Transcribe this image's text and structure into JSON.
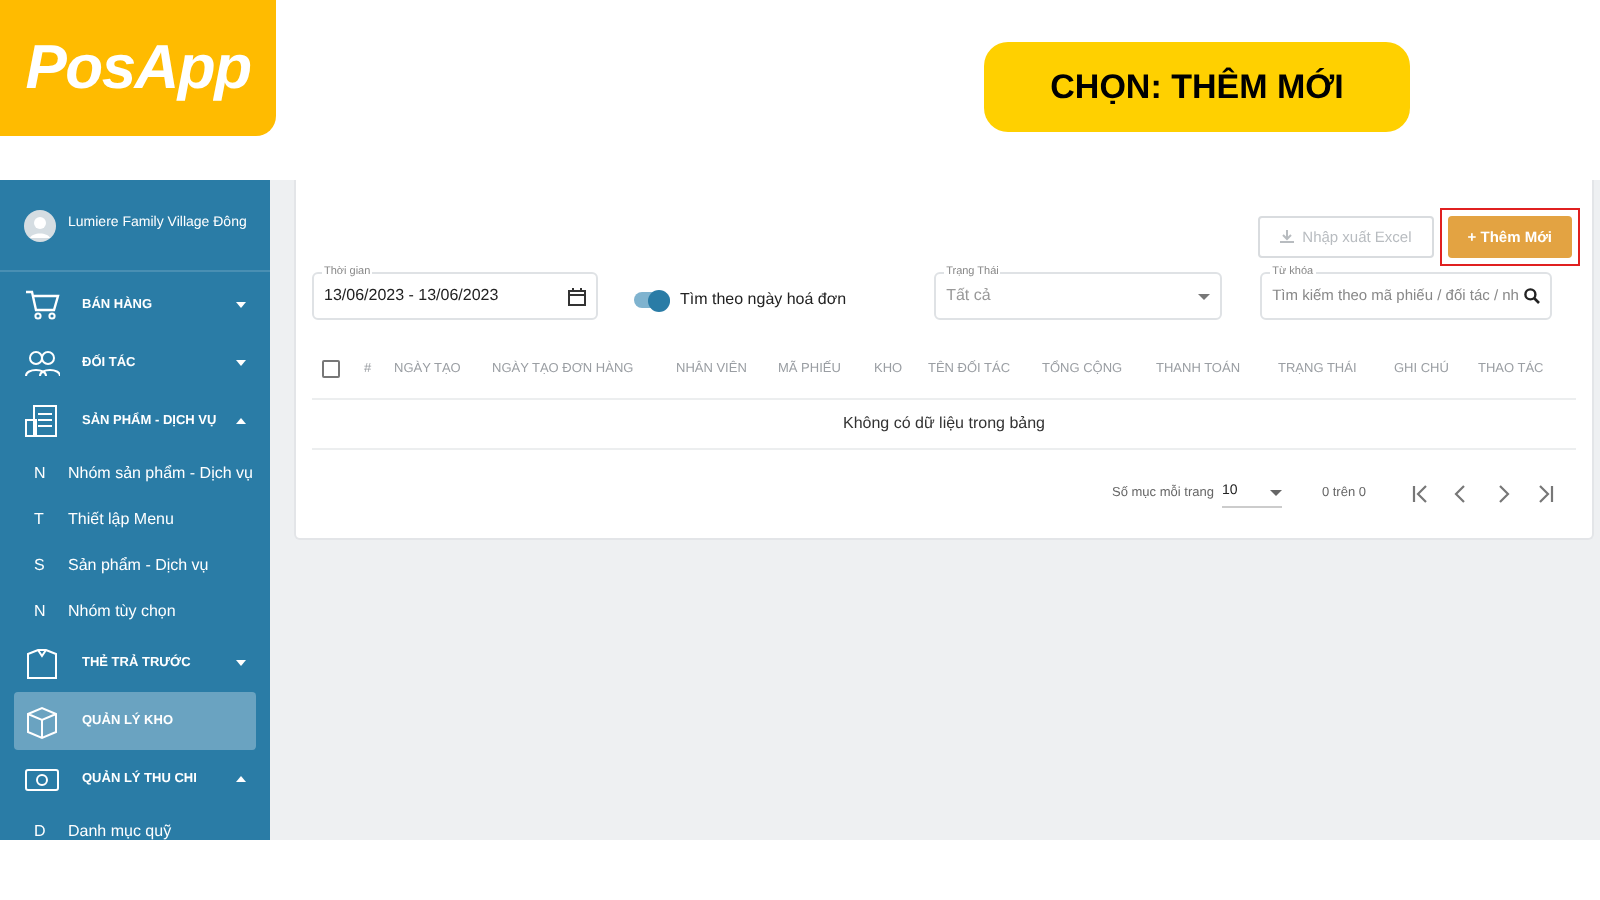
{
  "logo": {
    "text": "PosApp"
  },
  "banner": {
    "text": "CHỌN: THÊM MỚI"
  },
  "sidebar": {
    "user": "Lumiere Family Village Đông",
    "items": [
      {
        "kind": "group",
        "label": "BÁN HÀNG",
        "expanded": false,
        "selected": false
      },
      {
        "kind": "group",
        "label": "ĐỐI TÁC",
        "expanded": false,
        "selected": false
      },
      {
        "kind": "group",
        "label": "SẢN PHẨM - DỊCH VỤ",
        "expanded": true,
        "selected": false
      },
      {
        "kind": "sub",
        "letter": "N",
        "label": "Nhóm sản phẩm - Dịch vụ"
      },
      {
        "kind": "sub",
        "letter": "T",
        "label": "Thiết lập Menu"
      },
      {
        "kind": "sub",
        "letter": "S",
        "label": "Sản phẩm - Dịch vụ"
      },
      {
        "kind": "sub",
        "letter": "N",
        "label": "Nhóm tùy chọn"
      },
      {
        "kind": "group",
        "label": "THẺ TRẢ TRƯỚC",
        "expanded": false,
        "selected": false
      },
      {
        "kind": "link",
        "label": "QUẢN LÝ KHO",
        "selected": true
      },
      {
        "kind": "group",
        "label": "QUẢN LÝ THU CHI",
        "expanded": true,
        "selected": false
      },
      {
        "kind": "sub",
        "letter": "D",
        "label": "Danh mục quỹ"
      }
    ]
  },
  "toolbar": {
    "buttons": [
      {
        "kind": "excel",
        "label": "Nhập xuất Excel",
        "disabled": true,
        "highlighted": false
      },
      {
        "kind": "add",
        "label": "+ Thêm Mới",
        "disabled": false,
        "highlighted": true
      }
    ]
  },
  "filters": {
    "date": {
      "label": "Thời gian",
      "value": "13/06/2023 - 13/06/2023"
    },
    "toggle": {
      "label": "Tìm theo ngày hoá đơn",
      "on": true
    },
    "status": {
      "label": "Trạng Thái",
      "value": "Tất cả"
    },
    "keyword": {
      "label": "Từ khóa",
      "placeholder": "Tìm kiếm theo mã phiếu / đối tác / nh"
    }
  },
  "table": {
    "select_all": false,
    "columns": [
      "#",
      "NGÀY TẠO",
      "NGÀY TẠO ĐƠN HÀNG",
      "NHÂN VIÊN",
      "MÃ PHIẾU",
      "KHO",
      "TÊN ĐỐI TÁC",
      "TỔNG CỘNG",
      "THANH TOÁN",
      "TRẠNG THÁI",
      "GHI CHÚ",
      "THAO TÁC"
    ],
    "empty_message": "Không có dữ liệu trong bảng"
  },
  "pagination": {
    "per_page_label": "Số mục mỗi trang",
    "per_page": "10",
    "range": "0 trên 0"
  }
}
